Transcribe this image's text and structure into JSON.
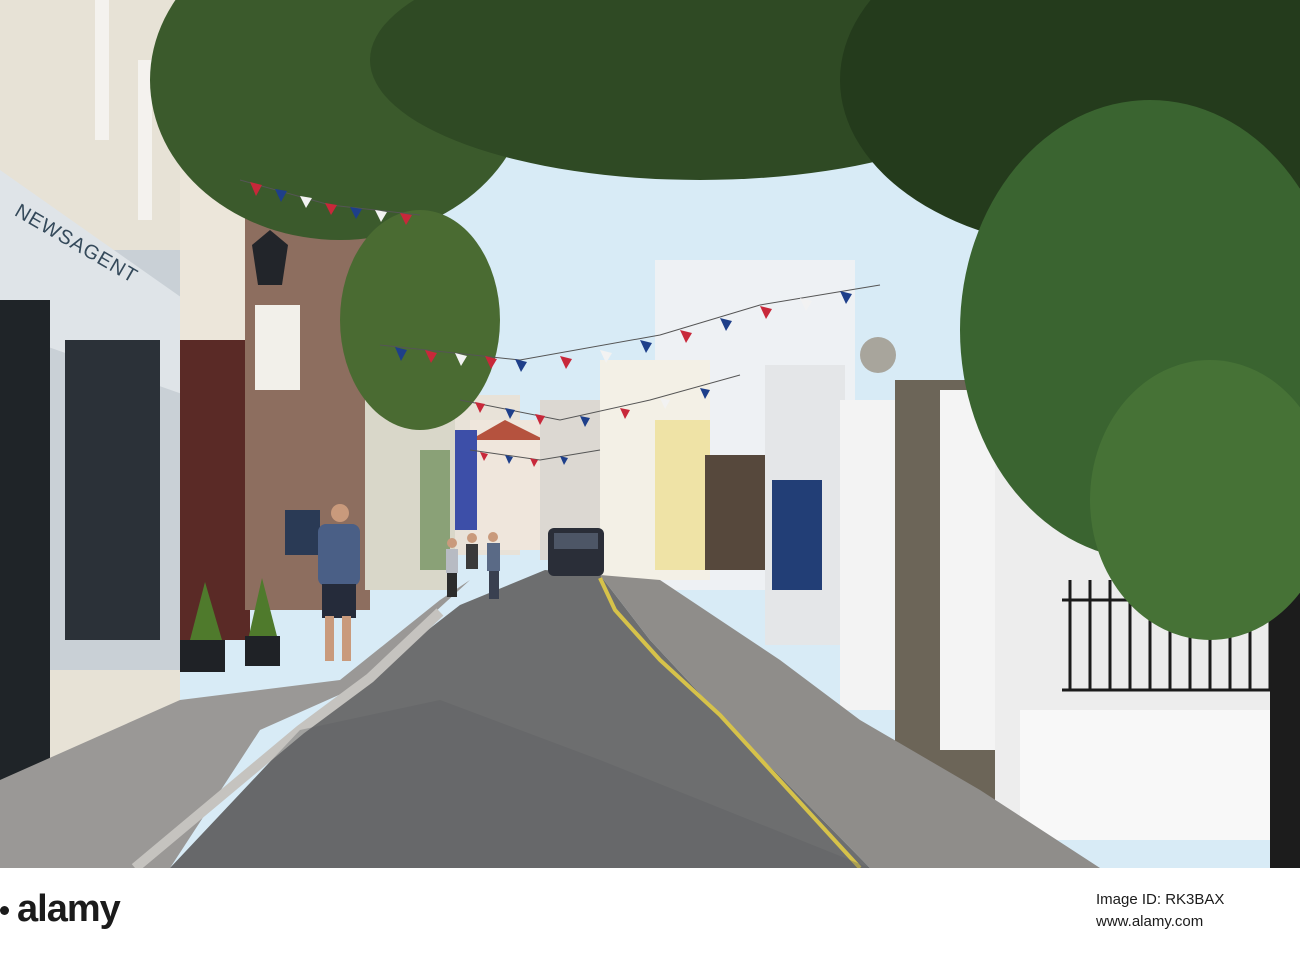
{
  "image": {
    "subject": "narrow cobbled street lined with shops and houses, bunting overhead, people walking"
  },
  "scene": {
    "shop_sign": "NEWSAGENT",
    "colors": {
      "sky": "#d8ebf6",
      "cobbles": "#6d6e6f",
      "pavement": "#9a9896",
      "foliage": "#2f4a24",
      "bunting_red": "#c8283a",
      "bunting_blue": "#1e3f8a",
      "bunting_white": "#f2f2f2"
    }
  },
  "watermark": {
    "logo": "alamy",
    "image_id": "Image ID: RK3BAX",
    "url": "www.alamy.com"
  }
}
